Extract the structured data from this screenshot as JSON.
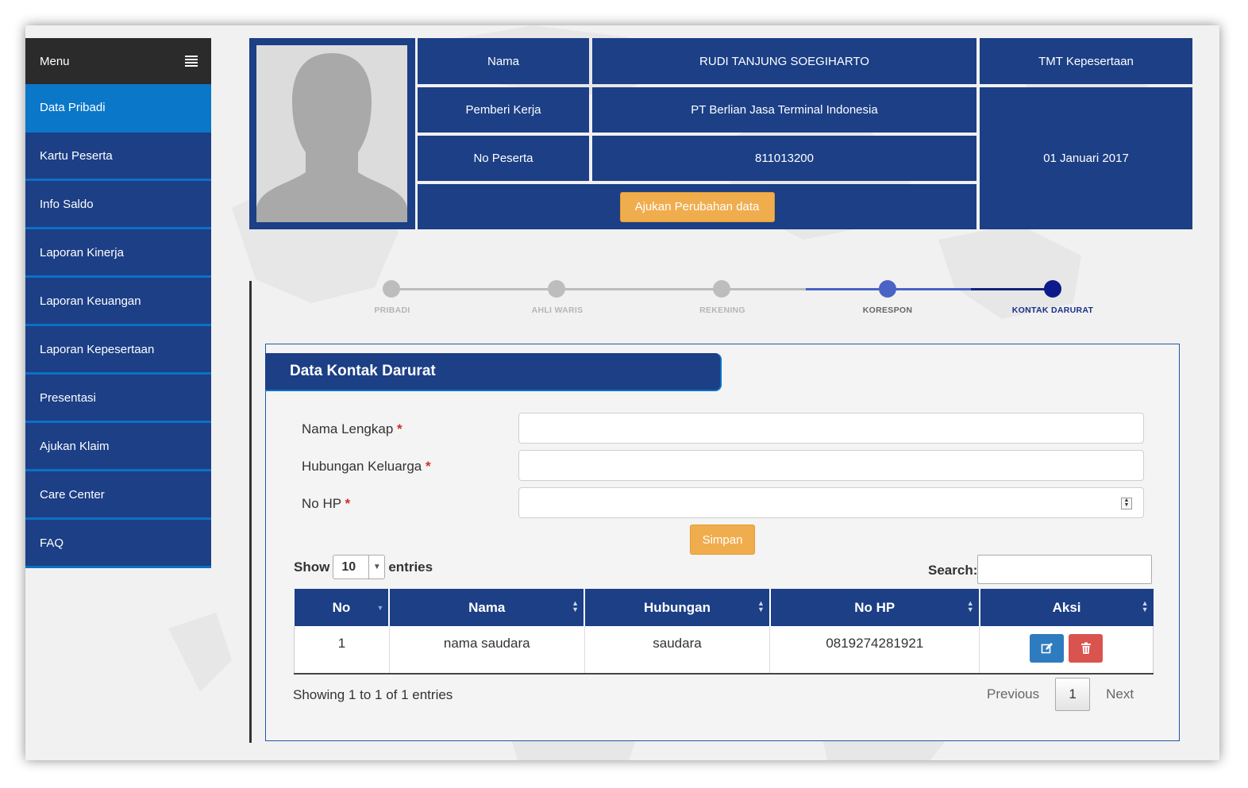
{
  "sidebar": {
    "menu_label": "Menu",
    "items": [
      {
        "label": "Data Pribadi"
      },
      {
        "label": "Kartu Peserta"
      },
      {
        "label": "Info Saldo"
      },
      {
        "label": "Laporan Kinerja"
      },
      {
        "label": "Laporan Keuangan"
      },
      {
        "label": "Laporan Kepesertaan"
      },
      {
        "label": "Presentasi"
      },
      {
        "label": "Ajukan Klaim"
      },
      {
        "label": "Care Center"
      },
      {
        "label": "FAQ"
      }
    ]
  },
  "profile": {
    "nama_label": "Nama",
    "nama_value": "RUDI TANJUNG SOEGIHARTO",
    "pemberi_label": "Pemberi Kerja",
    "pemberi_value": "PT Berlian Jasa Terminal Indonesia",
    "no_peserta_label": "No Peserta",
    "no_peserta_value": "811013200",
    "tmt_label": "TMT Kepesertaan",
    "tmt_value": "01 Januari 2017",
    "change_button": "Ajukan Perubahan data"
  },
  "steps": [
    {
      "label": "PRIBADI",
      "state": "done"
    },
    {
      "label": "AHLI WARIS",
      "state": "done"
    },
    {
      "label": "REKENING",
      "state": "done"
    },
    {
      "label": "KORESPON",
      "state": "previous"
    },
    {
      "label": "KONTAK DARURAT",
      "state": "current"
    }
  ],
  "form": {
    "title": "Data Kontak Darurat",
    "fields": [
      {
        "label": "Nama Lengkap",
        "value": ""
      },
      {
        "label": "Hubungan Keluarga",
        "value": ""
      },
      {
        "label": "No HP",
        "value": ""
      }
    ],
    "required_mark": "*",
    "save_button": "Simpan"
  },
  "table": {
    "show_label": "Show",
    "page_size": "10",
    "entries_label": "entries",
    "search_label": "Search:",
    "search_value": "",
    "columns": [
      "No",
      "Nama",
      "Hubungan",
      "No HP",
      "Aksi"
    ],
    "rows": [
      {
        "no": "1",
        "nama": "nama saudara",
        "hubungan": "saudara",
        "no_hp": "0819274281921"
      }
    ],
    "info": "Showing 1 to 1 of 1 entries",
    "previous": "Previous",
    "current_page": "1",
    "next": "Next"
  },
  "colors": {
    "primary": "#1c3f86",
    "active": "#0a77c8",
    "accent": "#f0ad4e",
    "delete": "#d9534f",
    "edit": "#2f7bbf"
  }
}
